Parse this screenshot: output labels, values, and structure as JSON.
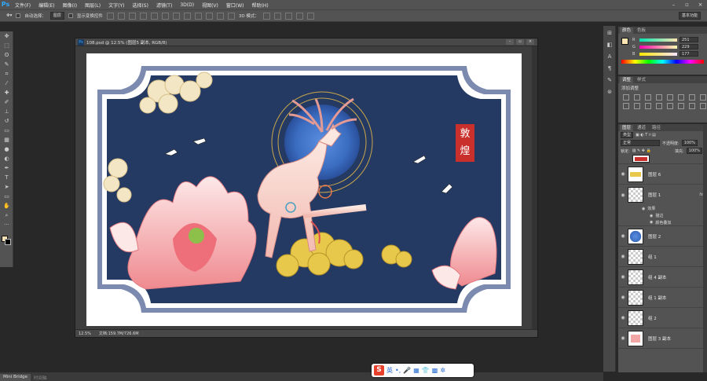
{
  "app": {
    "logo": "Ps"
  },
  "menu": [
    "文件(F)",
    "编辑(E)",
    "图像(I)",
    "图层(L)",
    "文字(Y)",
    "选择(S)",
    "滤镜(T)",
    "3D(D)",
    "视图(V)",
    "窗口(W)",
    "帮助(H)"
  ],
  "window_controls": [
    "–",
    "▫",
    "×"
  ],
  "options": {
    "auto_select_label": "自动选择：",
    "auto_select_value": "图层",
    "transform_label": "显示变换控件",
    "mode_3d_label": "3D 模式：",
    "workspace": "基本功能"
  },
  "document": {
    "title": "108.psd @ 12.5% (图层5 副本, RGB/8)",
    "zoom": "12.5%",
    "doc_size": "文档:159.7M/726.6M",
    "controls": [
      "–",
      "▫",
      "×"
    ]
  },
  "artwork": {
    "stamp_chars": [
      "敦",
      "煌"
    ],
    "colors": {
      "navy": "#243a63",
      "frame": "#7b8aae",
      "moon": "#3a6cc0",
      "gold": "#e8c84a",
      "pink": "#f2a6a6"
    }
  },
  "color_panel": {
    "tabs": [
      "颜色",
      "色板"
    ],
    "channels": [
      {
        "name": "R",
        "value": "251"
      },
      {
        "name": "G",
        "value": "229"
      },
      {
        "name": "B",
        "value": "177"
      }
    ],
    "fg_color": "#fbe5b1"
  },
  "adjust_panel": {
    "tabs": [
      "调整",
      "样式"
    ],
    "title": "添加调整"
  },
  "layers_panel": {
    "tabs": [
      "图层",
      "通道",
      "路径"
    ],
    "kind_filter": "类型",
    "blend_mode": "正常",
    "opacity_label": "不透明度:",
    "opacity": "100%",
    "lock_label": "锁定:",
    "fill_label": "填充:",
    "fill": "100%",
    "layers": [
      {
        "name": "图层 6",
        "fx": ""
      },
      {
        "name": "图层 1",
        "fx": "fx"
      },
      {
        "name": "图层 2",
        "fx": ""
      },
      {
        "name": "组 1",
        "fx": ""
      },
      {
        "name": "组 4 副本",
        "fx": ""
      },
      {
        "name": "组 1 副本",
        "fx": ""
      },
      {
        "name": "组 2",
        "fx": ""
      },
      {
        "name": "图层 3 副本",
        "fx": ""
      }
    ],
    "effects_label": "效果",
    "effects": [
      "描边",
      "颜色叠加"
    ]
  },
  "bottom_tabs": [
    "Mini Bridge",
    "时间轴"
  ],
  "ime": {
    "logo": "S",
    "lang": "英"
  }
}
